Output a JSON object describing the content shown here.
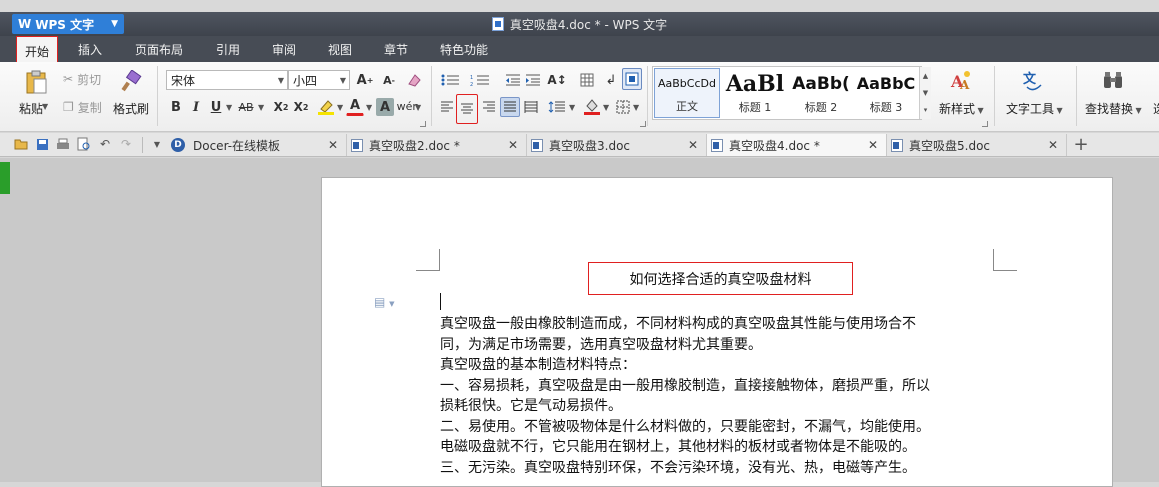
{
  "app": {
    "name": "WPS 文字",
    "window_title": "真空吸盘4.doc * - WPS 文字"
  },
  "menu": [
    "开始",
    "插入",
    "页面布局",
    "引用",
    "审阅",
    "视图",
    "章节",
    "特色功能"
  ],
  "ribbon": {
    "paste": "粘贴",
    "cut": "剪切",
    "copy": "复制",
    "format_painter": "格式刷",
    "font": "宋体",
    "font_size": "小四",
    "styles": [
      {
        "preview": "AaBbCcDd",
        "name": "正文"
      },
      {
        "preview": "AaBl",
        "name": "标题 1"
      },
      {
        "preview": "AaBb(",
        "name": "标题 2"
      },
      {
        "preview": "AaBbC",
        "name": "标题 3"
      }
    ],
    "new_style": "新样式",
    "text_tools": "文字工具",
    "find_replace": "查找替换",
    "partial_next": "选"
  },
  "tabs": [
    {
      "label": "Docer-在线模板",
      "active": false
    },
    {
      "label": "真空吸盘2.doc *",
      "active": false
    },
    {
      "label": "真空吸盘3.doc",
      "active": false
    },
    {
      "label": "真空吸盘4.doc *",
      "active": true
    },
    {
      "label": "真空吸盘5.doc",
      "active": false
    }
  ],
  "document": {
    "title": "如何选择合适的真空吸盘材料",
    "lines": [
      "真空吸盘一般由橡胶制造而成，不同材料构成的真空吸盘其性能与使用场合不",
      "同，为满足市场需要，选用真空吸盘材料尤其重要。",
      "真空吸盘的基本制造材料特点：",
      "一、容易损耗，真空吸盘是由一般用橡胶制造，直接接触物体，磨损严重，所以",
      "损耗很快。它是气动易损件。",
      "二、易使用。不管被吸物体是什么材料做的，只要能密封，不漏气，均能使用。",
      "电磁吸盘就不行，它只能用在钢材上，其他材料的板材或者物体是不能吸的。",
      "三、无污染。真空吸盘特别环保，不会污染环境，没有光、热，电磁等产生。"
    ]
  },
  "colors": {
    "titlebar": "#474c55",
    "logo": "#2f7fd8",
    "highlight_box": "#e02020"
  }
}
